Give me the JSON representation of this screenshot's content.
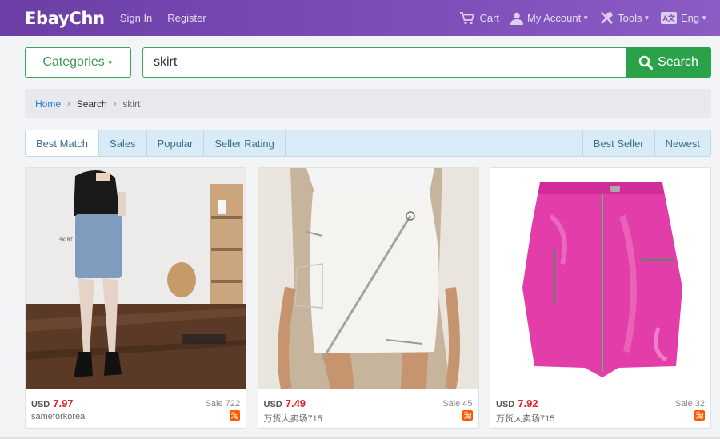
{
  "header": {
    "logo": "EbayChn",
    "sign_in": "Sign In",
    "register": "Register",
    "cart": "Cart",
    "my_account": "My Account",
    "tools": "Tools",
    "language": "Eng",
    "language_icon_text": "A文"
  },
  "search": {
    "categories_label": "Categories",
    "query": "skirt",
    "button_label": "Search"
  },
  "breadcrumb": {
    "home": "Home",
    "search": "Search",
    "current": "skirt"
  },
  "sort_tabs": {
    "left": [
      "Best Match",
      "Sales",
      "Popular",
      "Seller Rating"
    ],
    "right": [
      "Best Seller",
      "Newest"
    ],
    "active": "Best Match"
  },
  "products": [
    {
      "currency": "USD",
      "price": "7.97",
      "sales": "Sale 722",
      "seller": "sameforkorea",
      "badge": "淘"
    },
    {
      "currency": "USD",
      "price": "7.49",
      "sales": "Sale 45",
      "seller": "万货大卖场715",
      "badge": "淘"
    },
    {
      "currency": "USD",
      "price": "7.92",
      "sales": "Sale 32",
      "seller": "万货大卖场715",
      "badge": "淘"
    }
  ],
  "colors": {
    "header_gradient_start": "#6b3fa6",
    "header_gradient_end": "#8b5cc4",
    "accent_green": "#2aa24a",
    "price_red": "#d9252b",
    "link_blue": "#2a7fd0"
  }
}
